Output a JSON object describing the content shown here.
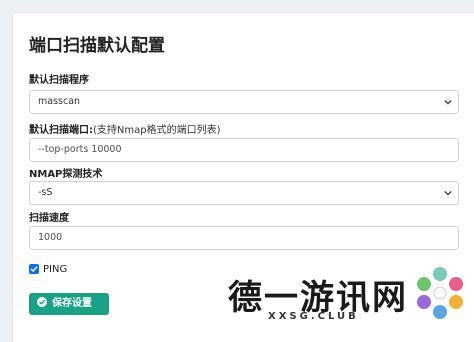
{
  "page": {
    "title": "端口扫描默认配置"
  },
  "scanner": {
    "label": "默认扫描程序",
    "value": "masscan"
  },
  "ports": {
    "label": "默认扫描端口:",
    "hint": "(支持Nmap格式的端口列表)",
    "value": "--top-ports 10000"
  },
  "nmap_tech": {
    "label": "NMAP探测技术",
    "value": "-sS"
  },
  "speed": {
    "label": "扫描速度",
    "value": "1000"
  },
  "ping": {
    "label": "PING",
    "checked": true
  },
  "save_button": {
    "label": "保存设置"
  },
  "watermark": {
    "text": "德一游讯网",
    "sub": "XXSG.CLUB"
  },
  "colors": {
    "accent_green": "#18a386",
    "checkbox_blue": "#0d6efd"
  }
}
